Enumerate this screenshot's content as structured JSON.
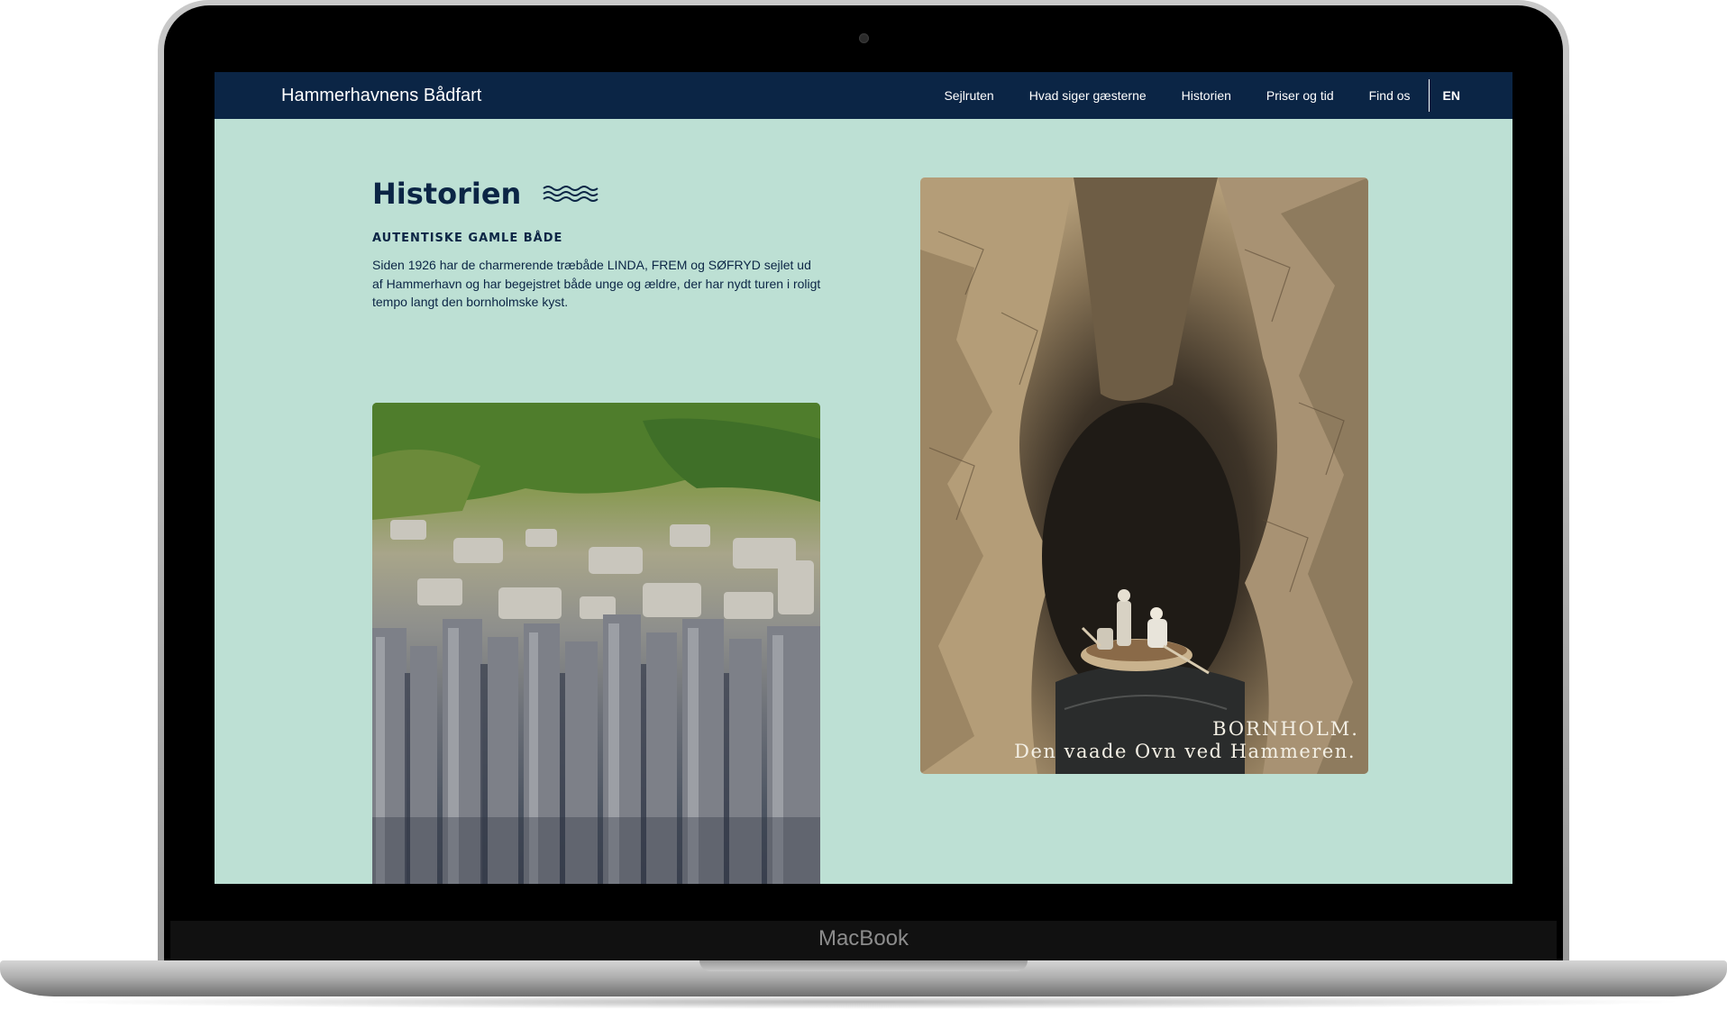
{
  "device": {
    "brand_label": "MacBook"
  },
  "header": {
    "logo": "Hammerhavnens Bådfart",
    "nav": [
      {
        "label": "Sejlruten"
      },
      {
        "label": "Hvad siger gæsterne"
      },
      {
        "label": "Historien"
      },
      {
        "label": "Priser og tid"
      },
      {
        "label": "Find os"
      }
    ],
    "lang": "EN"
  },
  "main": {
    "title": "Historien",
    "subheading": "AUTENTISKE GAMLE BÅDE",
    "intro": "Siden 1926 har de charmerende træbåde LINDA, FREM og SØFRYD sejlet ud af Hammerhavn og har begejstret både unge og ældre, der har nydt turen i roligt tempo langt den bornholmske kyst.",
    "postcard": {
      "caption_line1": "BORNHOLM.",
      "caption_line2": "Den vaade Ovn ved Hammeren."
    }
  },
  "colors": {
    "navy": "#0b2545",
    "mint": "#bde0d4"
  }
}
